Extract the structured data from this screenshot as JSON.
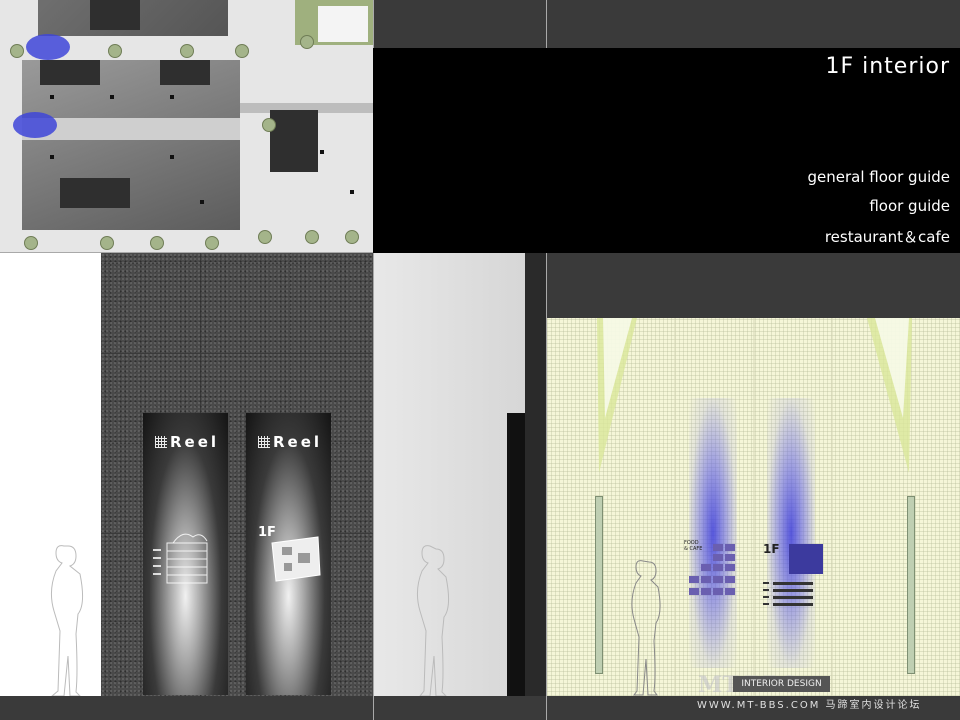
{
  "title": "1F  interior",
  "menu": [
    "general  floor guide",
    "floor guide",
    "restaurant＆cafe"
  ],
  "signs": {
    "left": {
      "logo": "Reel"
    },
    "right": {
      "logo": "Reel",
      "floor": "1F"
    }
  },
  "elevation": {
    "floor": "1F",
    "label": "FOOD & CAFE"
  },
  "watermark": {
    "logo": "MT-BBS",
    "badge": "INTERIOR DESIGN",
    "site": "WWW.MT-BBS.COM  马蹄室内设计论坛"
  },
  "colors": {
    "marker": "#3e45d8",
    "background": "#3a3a3a"
  }
}
